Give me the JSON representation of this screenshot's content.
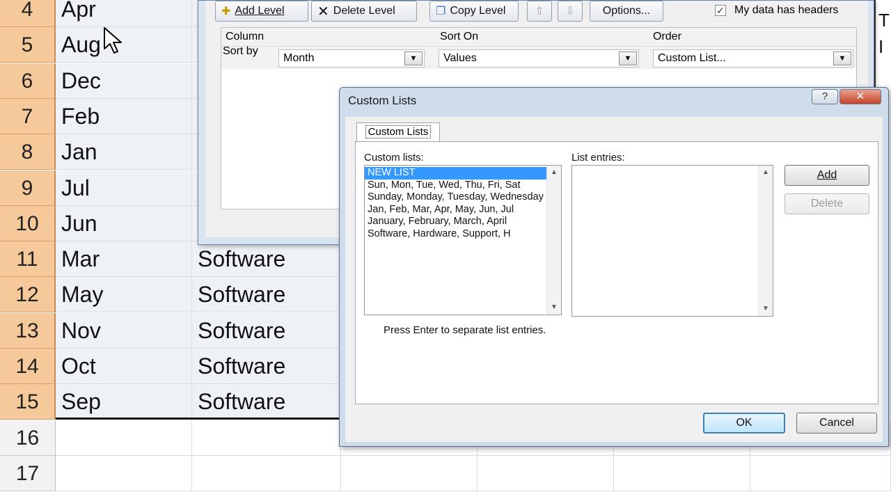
{
  "spreadsheet": {
    "rows": [
      {
        "num": "4",
        "month": "Apr",
        "category": ""
      },
      {
        "num": "5",
        "month": "Aug",
        "category": ""
      },
      {
        "num": "6",
        "month": "Dec",
        "category": ""
      },
      {
        "num": "7",
        "month": "Feb",
        "category": ""
      },
      {
        "num": "8",
        "month": "Jan",
        "category": ""
      },
      {
        "num": "9",
        "month": "Jul",
        "category": ""
      },
      {
        "num": "10",
        "month": "Jun",
        "category": ""
      },
      {
        "num": "11",
        "month": "Mar",
        "category": "Software"
      },
      {
        "num": "12",
        "month": "May",
        "category": "Software"
      },
      {
        "num": "13",
        "month": "Nov",
        "category": "Software"
      },
      {
        "num": "14",
        "month": "Oct",
        "category": "Software"
      },
      {
        "num": "15",
        "month": "Sep",
        "category": "Software"
      },
      {
        "num": "16",
        "month": "",
        "category": ""
      },
      {
        "num": "17",
        "month": "",
        "category": ""
      }
    ],
    "right_edge_text": [
      "T",
      "I"
    ]
  },
  "sort_dialog": {
    "toolbar": {
      "add_level": "Add Level",
      "delete_level": "Delete Level",
      "copy_level": "Copy Level",
      "move_up": "⇧",
      "move_down": "⇩",
      "options": "Options...",
      "headers_checkbox_label": "My data has headers",
      "headers_checked": "✓"
    },
    "columns": {
      "column": "Column",
      "sort_on": "Sort On",
      "order": "Order"
    },
    "level": {
      "label": "Sort by",
      "column_value": "Month",
      "sort_on_value": "Values",
      "order_value": "Custom List..."
    }
  },
  "custom_lists_dialog": {
    "title": "Custom Lists",
    "help_glyph": "?",
    "close_glyph": "✕",
    "tab_label": "Custom Lists",
    "custom_lists_label": "Custom lists:",
    "list_entries_label": "List entries:",
    "custom_lists": [
      "NEW LIST",
      "Sun, Mon, Tue, Wed, Thu, Fri, Sat",
      "Sunday, Monday, Tuesday, Wednesday",
      "Jan, Feb, Mar, Apr, May, Jun, Jul",
      "January, February, March, April",
      "Software, Hardware, Support, H"
    ],
    "selected_index": 0,
    "add_button": "Add",
    "delete_button": "Delete",
    "hint": "Press Enter to separate list entries.",
    "ok_button": "OK",
    "cancel_button": "Cancel"
  }
}
